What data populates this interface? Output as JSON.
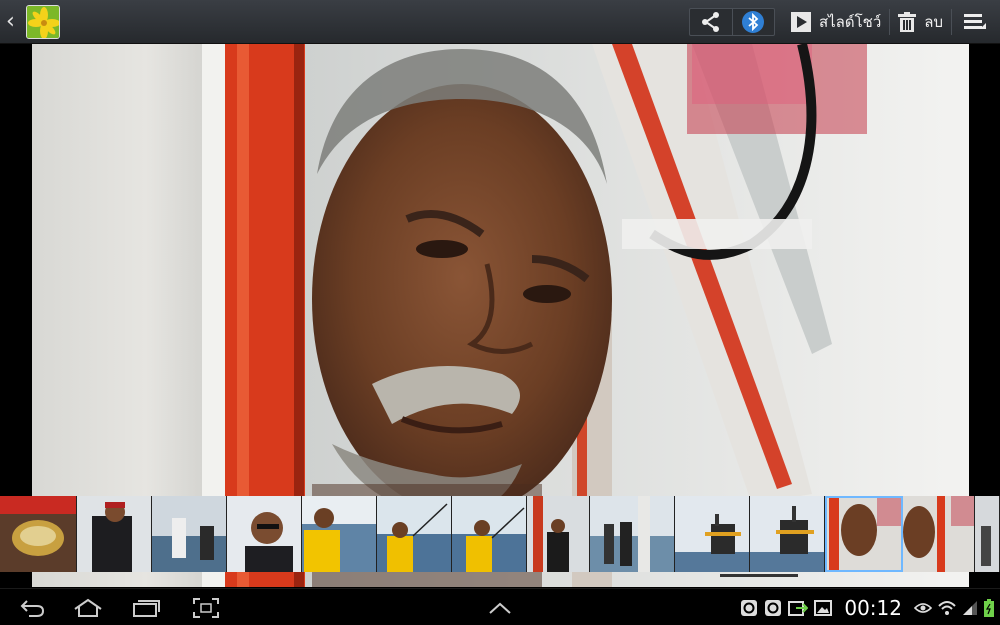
{
  "action_bar": {
    "back_icon": "chevron-left-icon",
    "app_icon": "gallery-app-icon",
    "share_icon": "share-icon",
    "bluetooth_icon": "bluetooth-icon",
    "slideshow_label": "สไลด์โชว์",
    "delete_label": "ลบ",
    "menu_icon": "overflow-menu-icon"
  },
  "filmstrip": {
    "selected_index": 11,
    "thumbnails": [
      "thumb-cooking-pot",
      "thumb-man-on-boat",
      "thumb-people-fishing",
      "thumb-man-sunglasses",
      "thumb-man-yellow-shirt",
      "thumb-man-fishing-yellow",
      "thumb-man-fishing-yellow-2",
      "thumb-boat-railing",
      "thumb-fishers-at-sea",
      "thumb-oil-platform",
      "thumb-oil-platform-2",
      "thumb-old-man-portrait",
      "thumb-old-man-portrait-2",
      "thumb-partial"
    ]
  },
  "navbar": {
    "back_icon": "nav-back-icon",
    "home_icon": "nav-home-icon",
    "recents_icon": "nav-recents-icon",
    "screenshot_icon": "nav-screenshot-icon",
    "up_icon": "nav-up-chevron-icon"
  },
  "status": {
    "time": "00:12",
    "battery_percent": 100,
    "icons": [
      "notif-circle-icon",
      "notif-circle-icon",
      "notif-sync-icon",
      "notif-image-icon",
      "eye-icon",
      "wifi-icon",
      "signal-icon",
      "battery-icon"
    ]
  }
}
